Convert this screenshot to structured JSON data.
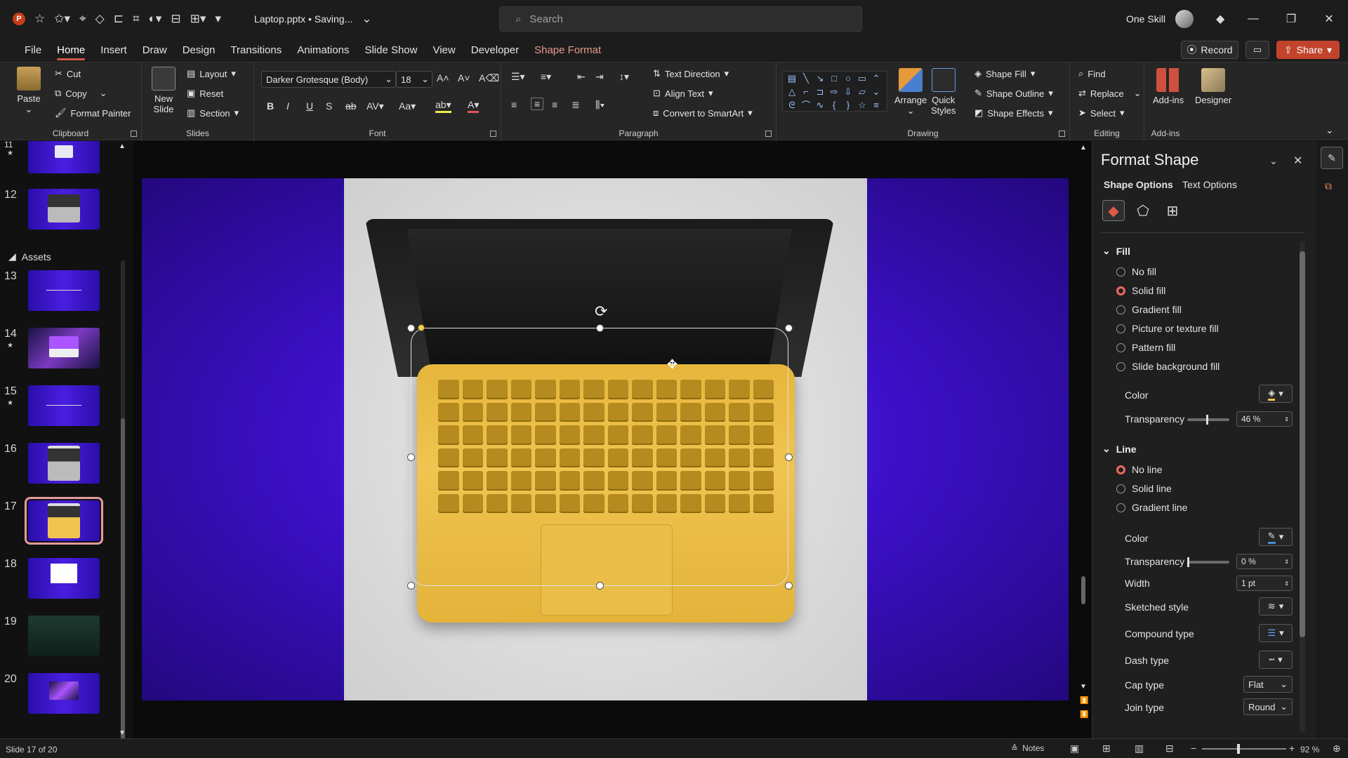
{
  "titlebar": {
    "doc_title": "Laptop.pptx • Saving...",
    "search_placeholder": "Search",
    "user_name": "One Skill"
  },
  "tabs": [
    "File",
    "Home",
    "Insert",
    "Draw",
    "Design",
    "Transitions",
    "Animations",
    "Slide Show",
    "View",
    "Developer",
    "Shape Format"
  ],
  "tab_active": "Home",
  "right_buttons": {
    "record": "Record",
    "share": "Share"
  },
  "ribbon": {
    "clipboard": {
      "label": "Clipboard",
      "paste": "Paste",
      "cut": "Cut",
      "copy": "Copy",
      "format_painter": "Format Painter"
    },
    "slides": {
      "label": "Slides",
      "new_slide_line1": "New",
      "new_slide_line2": "Slide",
      "layout": "Layout",
      "reset": "Reset",
      "section": "Section"
    },
    "font": {
      "label": "Font",
      "font_name": "Darker Grotesque (Body)",
      "font_size": "18"
    },
    "paragraph": {
      "label": "Paragraph",
      "text_direction": "Text Direction",
      "align_text": "Align Text",
      "convert_smartart": "Convert to SmartArt"
    },
    "drawing": {
      "label": "Drawing",
      "arrange": "Arrange",
      "quick_styles_line1": "Quick",
      "quick_styles_line2": "Styles",
      "shape_fill": "Shape Fill",
      "shape_outline": "Shape Outline",
      "shape_effects": "Shape Effects"
    },
    "editing": {
      "label": "Editing",
      "find": "Find",
      "replace": "Replace",
      "select": "Select"
    },
    "addins": {
      "label": "Add-ins",
      "addins": "Add-ins",
      "designer": "Designer"
    }
  },
  "thumbnails": {
    "section_name": "Assets",
    "slides": [
      {
        "num": "12",
        "star": false
      },
      {
        "num": "13",
        "star": false
      },
      {
        "num": "14",
        "star": true
      },
      {
        "num": "15",
        "star": true
      },
      {
        "num": "16",
        "star": false
      },
      {
        "num": "17",
        "star": false,
        "selected": true
      },
      {
        "num": "18",
        "star": false
      },
      {
        "num": "19",
        "star": false
      },
      {
        "num": "20",
        "star": false
      }
    ]
  },
  "format_pane": {
    "title": "Format Shape",
    "tab_shape": "Shape Options",
    "tab_text": "Text Options",
    "fill": {
      "heading": "Fill",
      "options": [
        "No fill",
        "Solid fill",
        "Gradient fill",
        "Picture or texture fill",
        "Pattern fill",
        "Slide background fill"
      ],
      "selected": "Solid fill",
      "color_label": "Color",
      "transparency_label": "Transparency",
      "transparency_value": "46 %",
      "transparency_fraction": 0.46
    },
    "line": {
      "heading": "Line",
      "options": [
        "No line",
        "Solid line",
        "Gradient line"
      ],
      "selected": "No line",
      "color_label": "Color",
      "transparency_label": "Transparency",
      "transparency_value": "0 %",
      "width_label": "Width",
      "width_value": "1 pt",
      "sketched_label": "Sketched style",
      "compound_label": "Compound type",
      "dash_label": "Dash type",
      "cap_label": "Cap type",
      "cap_value": "Flat",
      "join_label": "Join type",
      "join_value": "Round"
    }
  },
  "statusbar": {
    "slide_count": "Slide 17 of 20",
    "notes": "Notes",
    "zoom": "92 %"
  },
  "colors": {
    "accent": "#d0584b",
    "share": "#c2432b",
    "slide_bg": "#3c10c8",
    "laptop_fill": "#f0c450"
  }
}
